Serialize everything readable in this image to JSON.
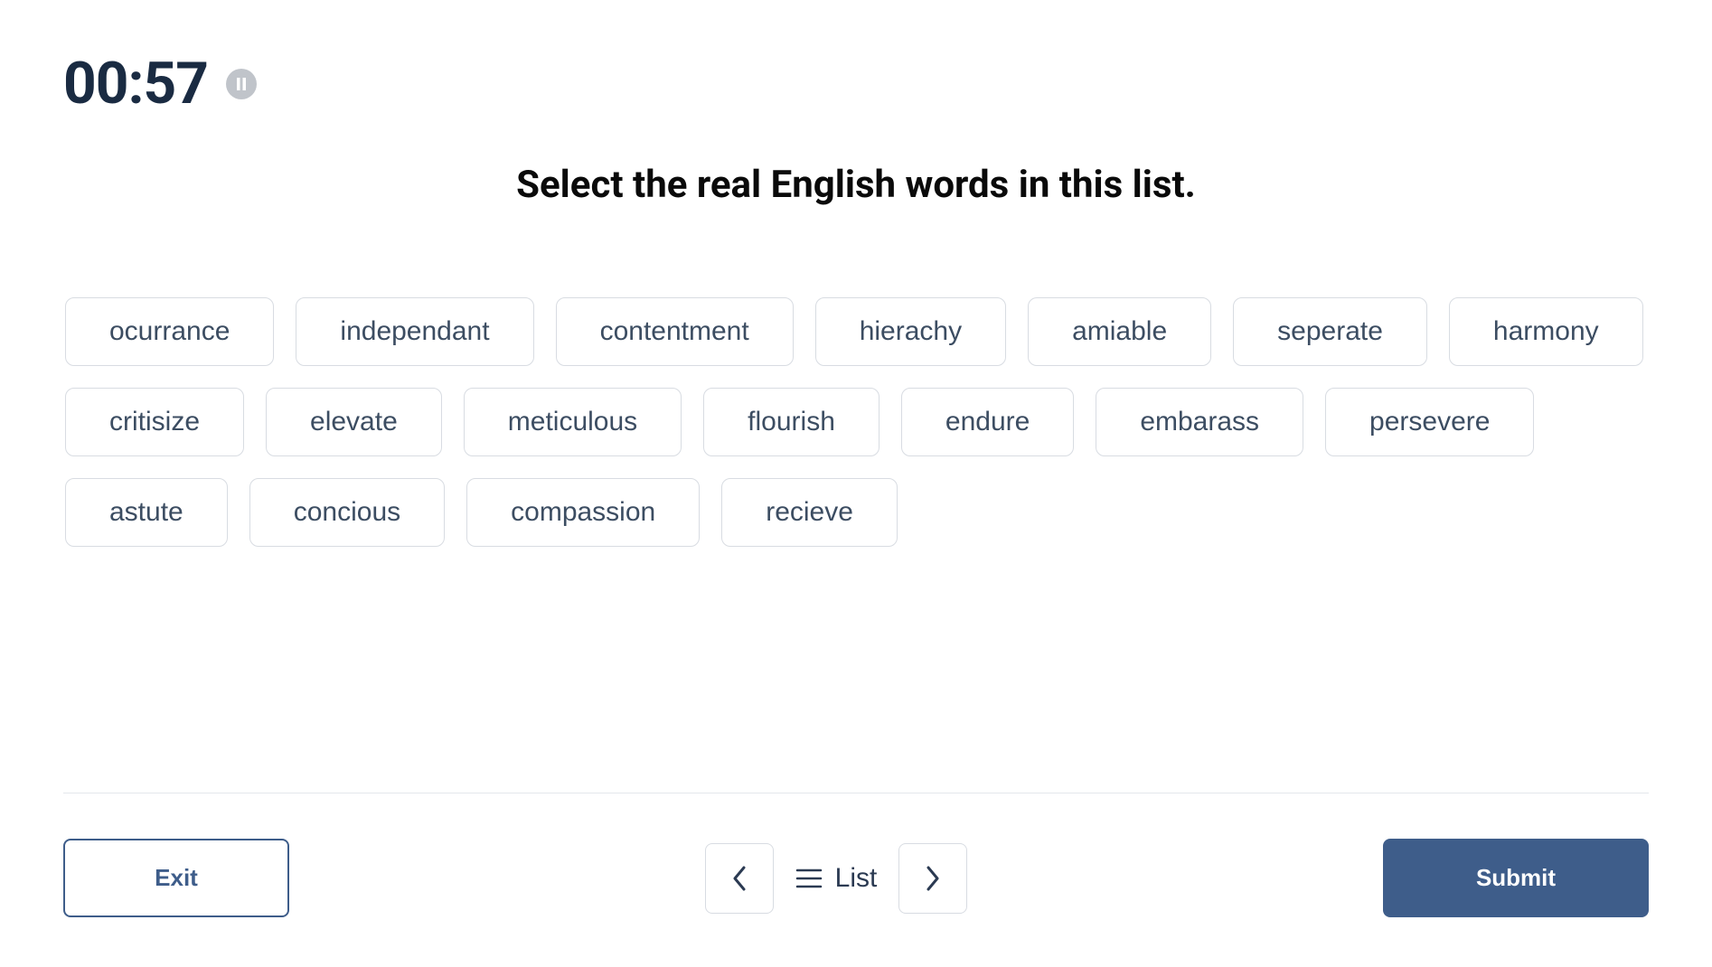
{
  "timer": "00:57",
  "prompt": "Select the real English words in this list.",
  "words": [
    "ocurrance",
    "independant",
    "contentment",
    "hierachy",
    "amiable",
    "seperate",
    "harmony",
    "critisize",
    "elevate",
    "meticulous",
    "flourish",
    "endure",
    "embarass",
    "persevere",
    "astute",
    "concious",
    "compassion",
    "recieve"
  ],
  "footer": {
    "exit": "Exit",
    "list": "List",
    "submit": "Submit"
  }
}
